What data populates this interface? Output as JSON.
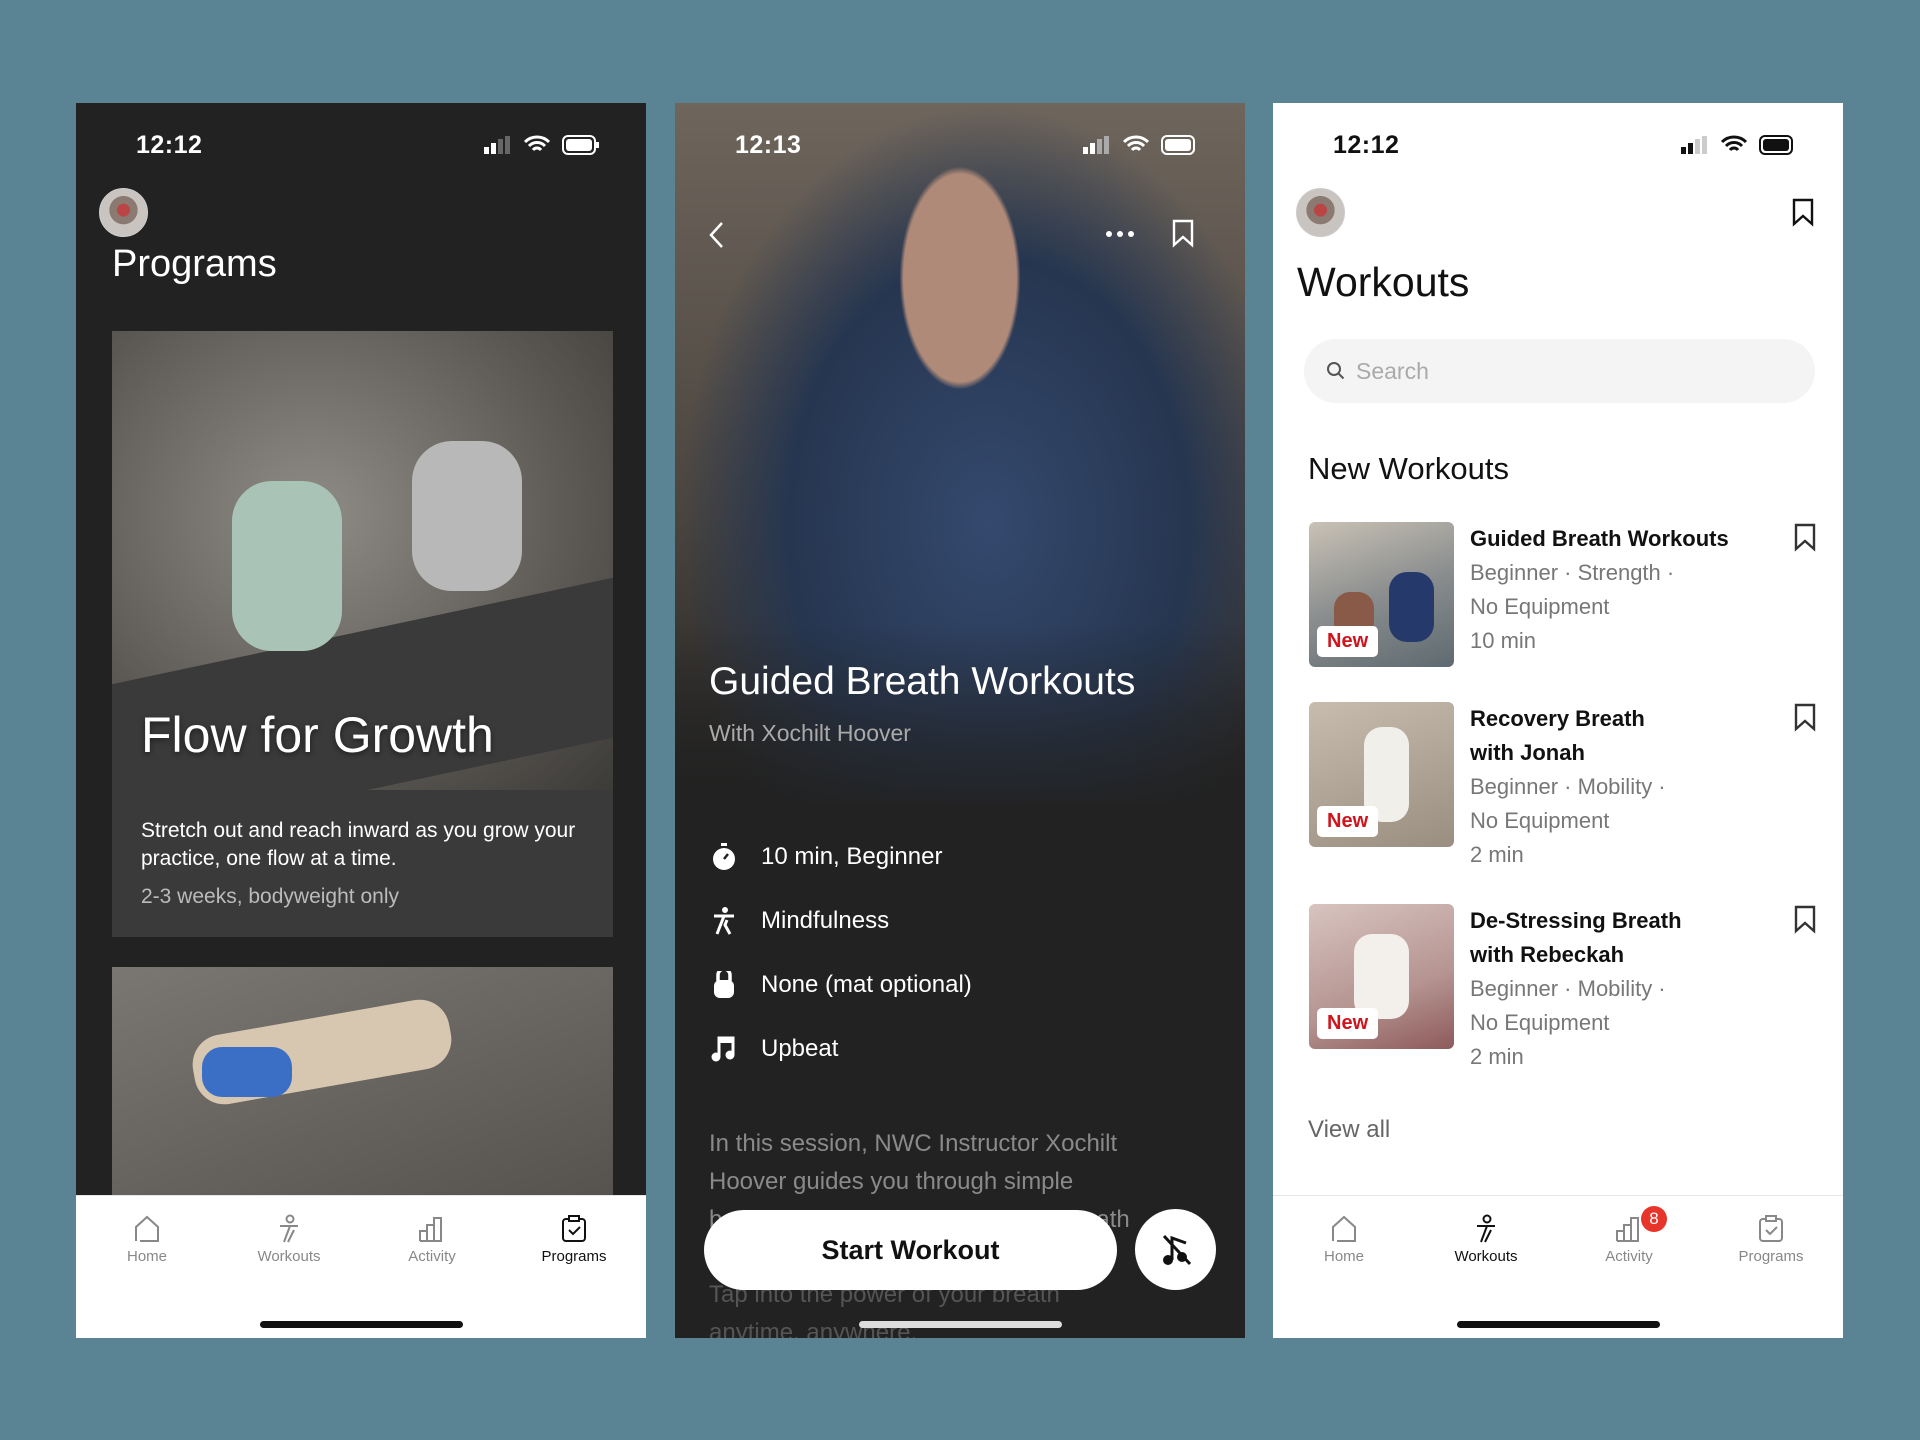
{
  "colors": {
    "background": "#5a8494",
    "dark": "#222222",
    "accent_red": "#d0141e"
  },
  "programs_screen": {
    "status": {
      "time": "12:12"
    },
    "title": "Programs",
    "featured": {
      "title": "Flow for Growth",
      "description": "Stretch out and reach inward as you grow your practice, one flow at a time.",
      "meta": "2-3 weeks, bodyweight only"
    },
    "nav": [
      {
        "label": "Home",
        "icon": "home-icon"
      },
      {
        "label": "Workouts",
        "icon": "workouts-icon"
      },
      {
        "label": "Activity",
        "icon": "activity-icon"
      },
      {
        "label": "Programs",
        "icon": "programs-icon",
        "active": true
      }
    ]
  },
  "detail_screen": {
    "status": {
      "time": "12:13"
    },
    "title": "Guided Breath Workouts",
    "subtitle": "With Xochilt Hoover",
    "features": [
      {
        "icon": "stopwatch-icon",
        "label": "10 min, Beginner"
      },
      {
        "icon": "activity-figure-icon",
        "label": "Mindfulness"
      },
      {
        "icon": "kettlebell-icon",
        "label": "None (mat optional)"
      },
      {
        "icon": "music-note-icon",
        "label": "Upbeat"
      }
    ],
    "description_lines": [
      "In this session, NWC Instructor Xochilt",
      "Hoover guides you through simple",
      "b",
      "reath",
      "Tap into the power of your breath",
      "anytime, anywhere."
    ],
    "start_button": "Start Workout",
    "music_toggle_icon": "music-off-icon"
  },
  "workouts_screen": {
    "status": {
      "time": "12:12"
    },
    "title": "Workouts",
    "search_placeholder": "Search",
    "section_title": "New Workouts",
    "items": [
      {
        "title1": "Guided Breath Workouts",
        "title2": "",
        "line1": "Beginner · Strength ·",
        "line2": "No Equipment",
        "line3": "10 min",
        "badge": "New"
      },
      {
        "title1": "Recovery Breath",
        "title2": "with Jonah",
        "line1": "Beginner · Mobility ·",
        "line2": "No Equipment",
        "line3": "2 min",
        "badge": "New"
      },
      {
        "title1": "De-Stressing Breath",
        "title2": "with Rebeckah",
        "line1": "Beginner · Mobility ·",
        "line2": "No Equipment",
        "line3": "2 min",
        "badge": "New"
      }
    ],
    "view_all": "View all",
    "nav": [
      {
        "label": "Home",
        "icon": "home-icon"
      },
      {
        "label": "Workouts",
        "icon": "workouts-icon",
        "active": true
      },
      {
        "label": "Activity",
        "icon": "activity-icon",
        "badge": "8"
      },
      {
        "label": "Programs",
        "icon": "programs-icon"
      }
    ]
  }
}
